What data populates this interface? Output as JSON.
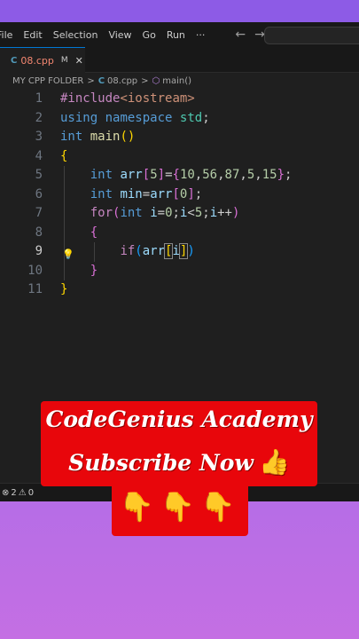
{
  "menu": {
    "items": [
      "File",
      "Edit",
      "Selection",
      "View",
      "Go",
      "Run",
      "···"
    ],
    "back_glyph": "←",
    "forward_glyph": "→"
  },
  "tab": {
    "label": "08.cpp",
    "modified_glyph": "M",
    "close_glyph": "✕",
    "file_glyph": "C"
  },
  "breadcrumb": {
    "folder": "MY CPP FOLDER",
    "file": "08.cpp",
    "symbol": "main()",
    "separator": ">",
    "file_glyph": "C",
    "symbol_glyph": "⬡"
  },
  "editor": {
    "active_line": 9,
    "lines": [
      {
        "n": "1",
        "code": "#include<iostream>"
      },
      {
        "n": "2",
        "code": "using namespace std;"
      },
      {
        "n": "3",
        "code": "int main()"
      },
      {
        "n": "4",
        "code": "{"
      },
      {
        "n": "5",
        "code": "    int arr[5]={10,56,87,5,15};"
      },
      {
        "n": "6",
        "code": "    int min=arr[0];"
      },
      {
        "n": "7",
        "code": "    for(int i=0;i<5;i++)"
      },
      {
        "n": "8",
        "code": "    {"
      },
      {
        "n": "9",
        "code": "        if(arr[i])"
      },
      {
        "n": "10",
        "code": "    }"
      },
      {
        "n": "11",
        "code": "}"
      }
    ],
    "lightbulb_glyph": "💡"
  },
  "status": {
    "errors": "2",
    "warnings": "0",
    "error_glyph": "⊗",
    "warning_glyph": "⚠"
  },
  "promo": {
    "line1": "CodeGenius Academy",
    "line2": "Subscribe Now",
    "thumb_glyph": "👍",
    "pointing_glyphs": "👇👇👇"
  },
  "colors": {
    "accent_top": "#8d5be6",
    "accent_bottom": "#c46fe3",
    "promo_red": "#e8060b",
    "editor_bg": "#1f1f1f"
  }
}
